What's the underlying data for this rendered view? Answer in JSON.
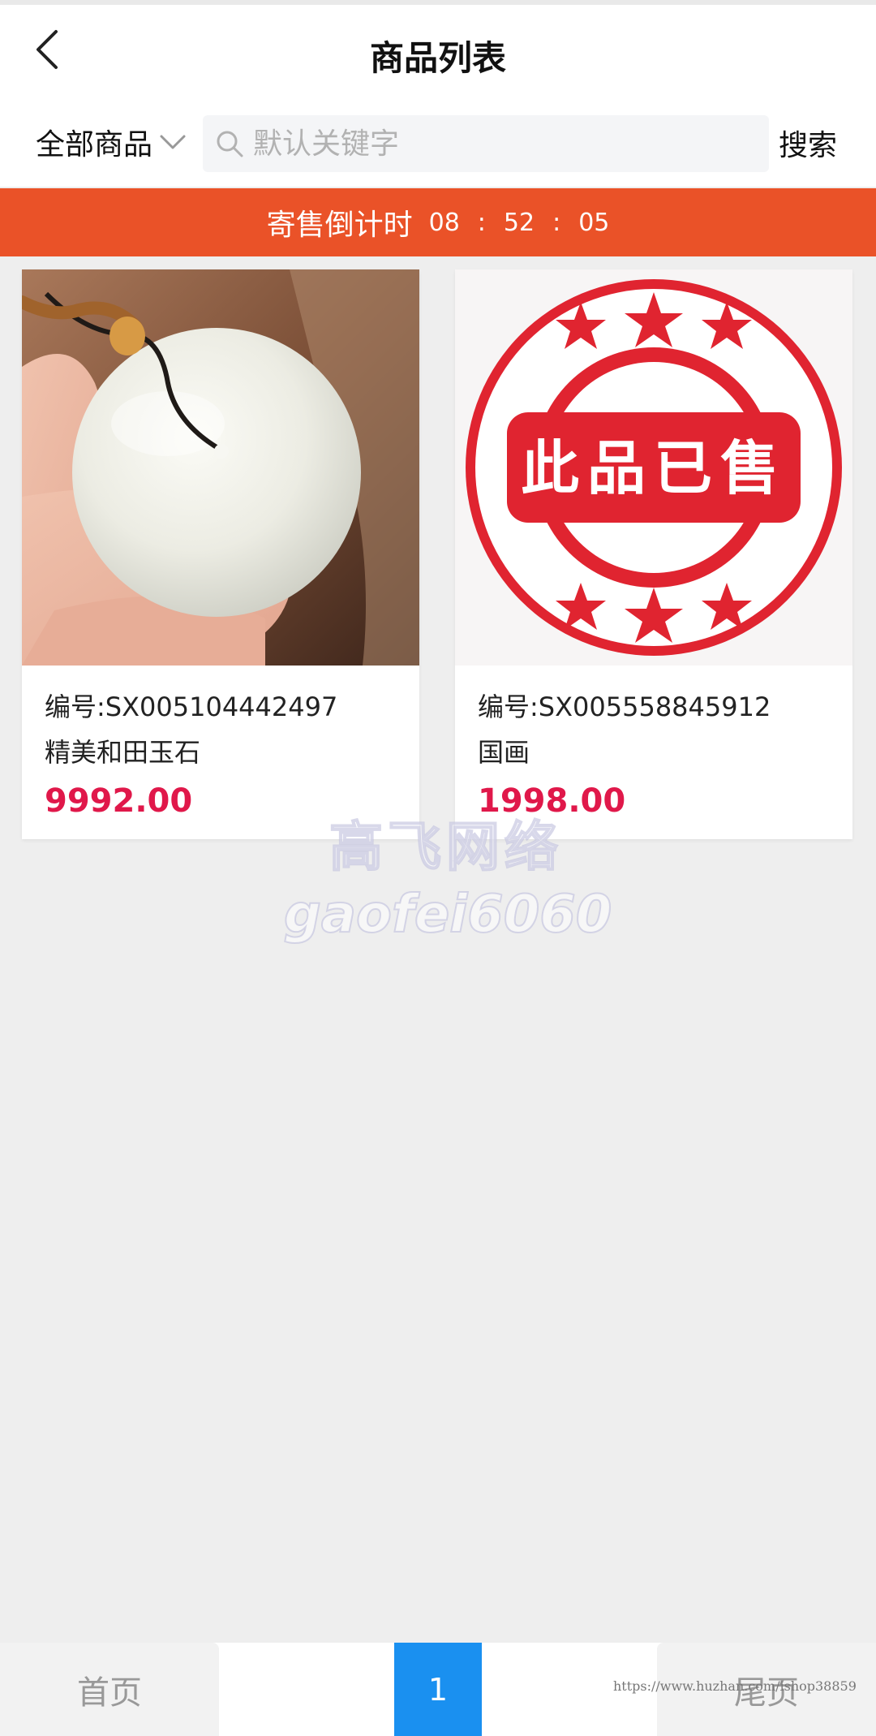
{
  "header": {
    "title": "商品列表",
    "back_icon": "chevron-left-icon"
  },
  "filter": {
    "category_label": "全部商品",
    "search_placeholder": "默认关键字",
    "search_value": "",
    "search_button": "搜索"
  },
  "countdown": {
    "label": "寄售倒计时",
    "hours": "08",
    "minutes": "52",
    "seconds": "05",
    "separator": ":"
  },
  "products": [
    {
      "code": "编号:SX005104442497",
      "name": "精美和田玉石",
      "price": "9992.00",
      "image": "white-jade-pendant-photo"
    },
    {
      "code": "编号:SX005558845912",
      "name": "国画",
      "price": "1998.00",
      "image": "sold-stamp",
      "stamp_text": "此品已售"
    }
  ],
  "watermark": {
    "line1": "高飞网络",
    "line2": "gaofei6060"
  },
  "pagination": {
    "first": "首页",
    "current": "1",
    "last": "尾页",
    "url_watermark": "https://www.huzhan.com/ishop38859"
  },
  "colors": {
    "accent": "#ea5228",
    "price": "#e0184a",
    "page_active": "#1a90f0",
    "stamp_red": "#e02430"
  }
}
